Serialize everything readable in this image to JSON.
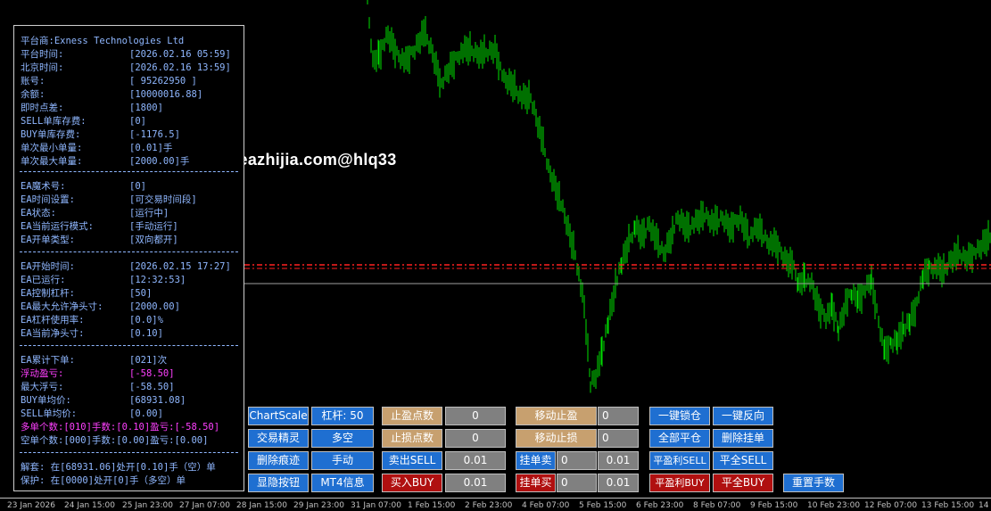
{
  "watermark": "www.eazhijia.com@hlq33",
  "colors": {
    "candle": "#00e000",
    "level_red": "#ff2020",
    "level_gray": "#a0a0a0",
    "text": "#8fb7ff",
    "magenta": "#ff40ff"
  },
  "info": {
    "g1": [
      {
        "k": "平台商:Exness Technologies Ltd",
        "v": ""
      },
      {
        "k": "平台时间:",
        "v": "[2026.02.16 05:59]"
      },
      {
        "k": "北京时间:",
        "v": "[2026.02.16 13:59]"
      },
      {
        "k": "账号:",
        "v": "[ 95262950 ]"
      },
      {
        "k": "余额:",
        "v": "[10000016.88]"
      },
      {
        "k": "即时点差:",
        "v": "[1800]"
      },
      {
        "k": "SELL单库存费:",
        "v": "[0]"
      },
      {
        "k": "BUY单库存费:",
        "v": "[-1176.5]"
      },
      {
        "k": "单次最小单量:",
        "v": "[0.01]手"
      },
      {
        "k": "单次最大单量:",
        "v": "[2000.00]手"
      }
    ],
    "g2": [
      {
        "k": "EA魔术号:",
        "v": "[0]"
      },
      {
        "k": "EA时间设置:",
        "v": "[可交易时间段]"
      },
      {
        "k": "EA状态:",
        "v": "[运行中]"
      },
      {
        "k": "EA当前运行模式:",
        "v": "[手动运行]"
      },
      {
        "k": "EA开单类型:",
        "v": "[双向都开]"
      }
    ],
    "g3": [
      {
        "k": "EA开始时间:",
        "v": "[2026.02.15 17:27]"
      },
      {
        "k": "EA已运行:",
        "v": "[12:32:53]"
      },
      {
        "k": "EA控制杠杆:",
        "v": "[50]"
      },
      {
        "k": "EA最大允许净头寸:",
        "v": "[2000.00]"
      },
      {
        "k": "EA杠杆使用率:",
        "v": "[0.0]%"
      },
      {
        "k": "EA当前净头寸:",
        "v": "[0.10]"
      }
    ],
    "g4": [
      {
        "k": "EA累计下单:",
        "v": "[021]次"
      },
      {
        "k": "浮动盈亏:",
        "v": "[-58.50]"
      },
      {
        "k": "最大浮亏:",
        "v": "[-58.50]"
      },
      {
        "k": "BUY单均价:",
        "v": "[68931.08]"
      },
      {
        "k": "SELL单均价:",
        "v": "[0.00]"
      },
      {
        "k": "多单个数:[010]手数:[0.10]盈亏:[-58.50]",
        "v": ""
      },
      {
        "k": "空单个数:[000]手数:[0.00]盈亏:[0.00]",
        "v": ""
      }
    ],
    "g5": [
      {
        "k": "解套: 在[68931.06]处开[0.10]手（空）单",
        "v": ""
      },
      {
        "k": "保护: 在[0000]处开[0]手（多空）单",
        "v": ""
      }
    ]
  },
  "buttons": {
    "chartscale": "ChartScale",
    "leverage": "杠杆: 50",
    "tp_points": "止盈点数",
    "tp_val": "0",
    "trail_tp": "移动止盈",
    "trail_tp_val": "0",
    "lock": "一键锁仓",
    "reverse": "一键反向",
    "trade_wizard": "交易精灵",
    "long_short": "多空",
    "sl_points": "止损点数",
    "sl_val": "0",
    "trail_sl": "移动止损",
    "trail_sl_val": "0",
    "close_all": "全部平仓",
    "delete_pending": "删除挂单",
    "delete_traces": "删除痕迹",
    "manual": "手动",
    "sell_out": "卖出SELL",
    "sell_lot": "0.01",
    "pending_sell": "挂单卖",
    "ps_a": "0",
    "ps_b": "0.01",
    "tp_sell": "平盈利SELL",
    "close_sell": "平全SELL",
    "show_hide": "显隐按钮",
    "mt4_info": "MT4信息",
    "buy_in": "买入BUY",
    "buy_lot": "0.01",
    "pending_buy": "挂单买",
    "pb_a": "0",
    "pb_b": "0.01",
    "tp_buy": "平盈利BUY",
    "close_buy": "平全BUY",
    "reset_lots": "重置手数"
  },
  "xaxis": [
    "23 Jan 2026",
    "24 Jan 15:00",
    "25 Jan 23:00",
    "27 Jan 07:00",
    "28 Jan 15:00",
    "29 Jan 23:00",
    "31 Jan 07:00",
    "1 Feb 15:00",
    "2 Feb 23:00",
    "4 Feb 07:00",
    "5 Feb 15:00",
    "6 Feb 23:00",
    "8 Feb 07:00",
    "9 Feb 15:00",
    "10 Feb 23:00",
    "12 Feb 07:00",
    "13 Feb 15:00",
    "14"
  ]
}
